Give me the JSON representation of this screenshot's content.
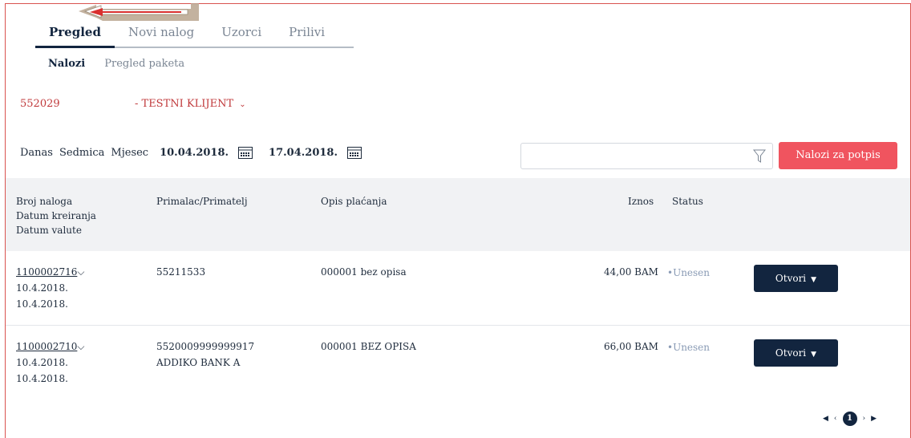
{
  "tabs": [
    {
      "label": "Pregled"
    },
    {
      "label": "Novi nalog"
    },
    {
      "label": "Uzorci"
    },
    {
      "label": "Prilivi"
    }
  ],
  "subtabs": [
    {
      "label": "Nalozi"
    },
    {
      "label": "Pregled paketa"
    }
  ],
  "client": {
    "id": "552029",
    "name": "- TESTNI KLIJENT"
  },
  "filters": {
    "periods": [
      "Danas",
      "Sedmica",
      "Mjesec"
    ],
    "date_from": "10.04.2018.",
    "date_to": "17.04.2018.",
    "search_value": "",
    "sign_button": "Nalozi za potpis"
  },
  "table": {
    "headers": {
      "order": [
        "Broj naloga",
        "Datum kreiranja",
        "Datum valute"
      ],
      "recipient": "Primalac/Primatelj",
      "description": "Opis plaćanja",
      "amount": "Iznos",
      "status": "Status"
    },
    "rows": [
      {
        "order_no": "1100002716",
        "created": "10.4.2018.",
        "value_date": "10.4.2018.",
        "recipient_line1": "55211533",
        "recipient_line2": "",
        "description": "000001 bez opisa",
        "amount": "44,00 BAM",
        "status": "Unesen",
        "action": "Otvori"
      },
      {
        "order_no": "1100002710",
        "created": "10.4.2018.",
        "value_date": "10.4.2018.",
        "recipient_line1": "5520009999999917",
        "recipient_line2": "ADDIKO BANK A",
        "description": "000001 BEZ OPISA",
        "amount": "66,00 BAM",
        "status": "Unesen",
        "action": "Otvori"
      }
    ]
  },
  "pagination": {
    "current_page": "1"
  },
  "colors": {
    "accent": "#f0545f",
    "primary": "#12253f",
    "client": "#c0393b",
    "status": "#8a9bb5"
  }
}
